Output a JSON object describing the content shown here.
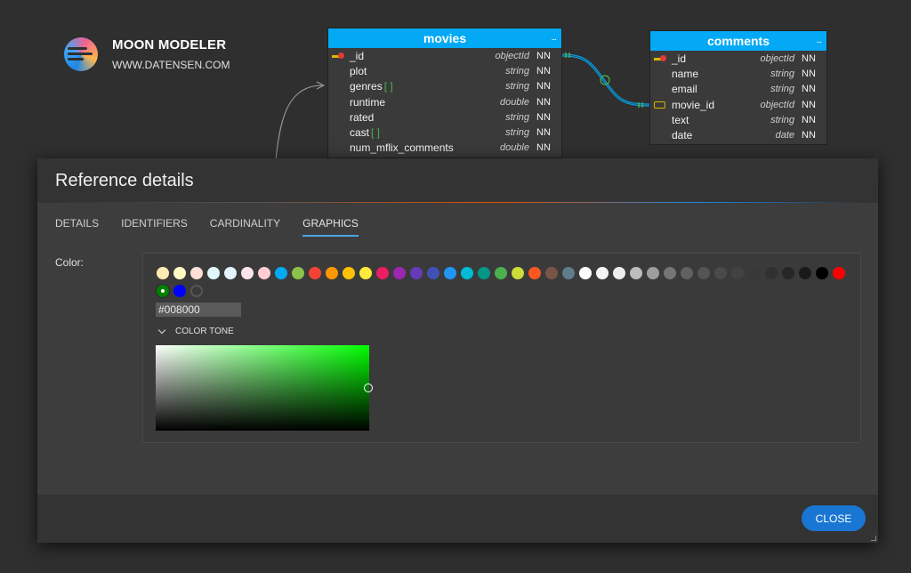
{
  "brand": {
    "name": "MOON MODELER",
    "url": "WWW.DATENSEN.COM"
  },
  "entities": {
    "movies": {
      "title": "movies",
      "menu": "...",
      "fields": [
        {
          "name": "_id",
          "type": "objectId",
          "nn": "NN",
          "icon": "primary-key-icon"
        },
        {
          "name": "plot",
          "type": "string",
          "nn": "NN"
        },
        {
          "name": "genres",
          "suffix": "[ ]",
          "type": "string",
          "nn": "NN"
        },
        {
          "name": "runtime",
          "type": "double",
          "nn": "NN"
        },
        {
          "name": "rated",
          "type": "string",
          "nn": "NN"
        },
        {
          "name": "cast",
          "suffix": "[ ]",
          "type": "string",
          "nn": "NN"
        },
        {
          "name": "num_mflix_comments",
          "type": "double",
          "nn": "NN"
        }
      ]
    },
    "comments": {
      "title": "comments",
      "menu": "...",
      "fields": [
        {
          "name": "_id",
          "type": "objectId",
          "nn": "NN",
          "icon": "primary-key-icon"
        },
        {
          "name": "name",
          "type": "string",
          "nn": "NN"
        },
        {
          "name": "email",
          "type": "string",
          "nn": "NN"
        },
        {
          "name": "movie_id",
          "type": "objectId",
          "nn": "NN",
          "icon": "foreign-key-icon"
        },
        {
          "name": "text",
          "type": "string",
          "nn": "NN"
        },
        {
          "name": "date",
          "type": "date",
          "nn": "NN"
        }
      ]
    }
  },
  "dialog": {
    "title": "Reference details",
    "tabs": [
      {
        "label": "DETAILS",
        "active": false
      },
      {
        "label": "IDENTIFIERS",
        "active": false
      },
      {
        "label": "CARDINALITY",
        "active": false
      },
      {
        "label": "GRAPHICS",
        "active": true
      }
    ],
    "color_label": "Color:",
    "hex_value": "#008000",
    "tone_label": "COLOR TONE",
    "tone_hue": "#00ff00",
    "close_label": "CLOSE",
    "swatches": [
      "#ffecb3",
      "#fff9c4",
      "#ffe0d6",
      "#e0f7fa",
      "#e3f2fd",
      "#fce4ec",
      "#ffcdd2",
      "#03a9f4",
      "#8bc34a",
      "#f44336",
      "#ff9800",
      "#ffc107",
      "#ffeb3b",
      "#e91e63",
      "#9c27b0",
      "#673ab7",
      "#3f51b5",
      "#2196f3",
      "#00bcd4",
      "#009688",
      "#4caf50",
      "#cddc39",
      "#ff5722",
      "#795548",
      "#607d8b",
      "#ffffff",
      "#f5f5f5",
      "#eeeeee",
      "#bdbdbd",
      "#9e9e9e",
      "#757575",
      "#616161",
      "#545454",
      "#4a4a4a",
      "#424242",
      "#383838",
      "#303030",
      "#262626",
      "#1a1a1a",
      "#000000",
      "#ff0000",
      "#008000",
      "#0000ff",
      "none"
    ],
    "selected_swatch": "#008000"
  }
}
